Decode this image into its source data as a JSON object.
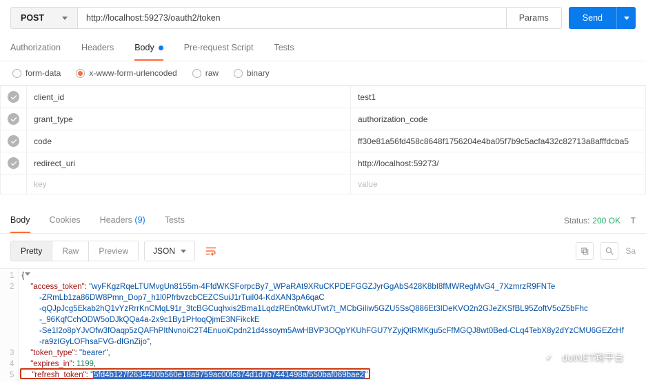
{
  "request": {
    "method": "POST",
    "url": "http://localhost:59273/oauth2/token",
    "params_label": "Params",
    "send_label": "Send"
  },
  "req_tabs": {
    "auth": "Authorization",
    "headers": "Headers",
    "body": "Body",
    "prerequest": "Pre-request Script",
    "tests": "Tests"
  },
  "body_types": {
    "formdata": "form-data",
    "urlencoded": "x-www-form-urlencoded",
    "raw": "raw",
    "binary": "binary"
  },
  "params": [
    {
      "key": "client_id",
      "value": "test1"
    },
    {
      "key": "grant_type",
      "value": "authorization_code"
    },
    {
      "key": "code",
      "value": "ff30e81a56fd458c8648f1756204e4ba05f7b9c5acfa432c82713a8afffdcba5"
    },
    {
      "key": "redirect_uri",
      "value": "http://localhost:59273/"
    }
  ],
  "placeholder": {
    "key": "key",
    "value": "value"
  },
  "resp_tabs": {
    "body": "Body",
    "cookies": "Cookies",
    "headers": "Headers",
    "headers_count": "(9)",
    "tests": "Tests"
  },
  "status": {
    "label": "Status:",
    "value": "200 OK",
    "time_abbrev": "T"
  },
  "viewer": {
    "pretty": "Pretty",
    "raw": "Raw",
    "preview": "Preview",
    "format": "JSON",
    "save_suffix": "Sa"
  },
  "json_response": {
    "line1_brace": "{",
    "l2_key": "\"access_token\"",
    "l2_val_part": "\"wyFKgzRqeLTUMvgUn8155m-4FfdWKSForpcBy7_WPaRAt9XRuCKPDEFGGZJyrGgAbS428K8bI8fMWRegMvG4_7XzmrzR9FNTe",
    "l2_c1": "-ZRmLb1za86DW8Pmn_Dop7_h1l0PfrbvzcbCEZCSuiJ1rTuiI04-KdXAN3pA6qaC",
    "l2_c2": "-qQJpJcg5Ekab2hQ1vYzRrrKnCMqL91r_3tcBGCuqhxis2Bma1LqdzREn0twkUTwt7t_MCbGiIiw5GZU5SsQ886Et3IDeKVO2n2GJeZKSfBL95ZoftV5oZ5bFhc",
    "l2_c3": "-_96KqfCchODW5oDJkQQa4a-2x9c1By1PHoqQjmE3NFikckE",
    "l2_c4": "-Se1I2o8pYJvOfw3fOaqp5zQAFhPItNvnoiC2T4EnuoiCpdn21d4ssoym5AwHBVP3OQpYKUhFGU7YZyjQtRMKgu5cFfMGQJ8wt0Bed-CLq4TebX8y2dYzCMU6GEZcHf",
    "l2_c5": "-ra9zIGyLOFhsaFVG-dIGnZijo\",",
    "l3_key": "\"token_type\"",
    "l3_val": "\"bearer\"",
    "l4_key": "\"expires_in\"",
    "l4_val": "1199",
    "l5_key": "\"refresh_token\"",
    "l5_val": "5fd4b127f2634400b560e18a9759ac00fc674d1d7b7441498af550baf069bae2"
  },
  "watermark": "dotNET跨平台"
}
